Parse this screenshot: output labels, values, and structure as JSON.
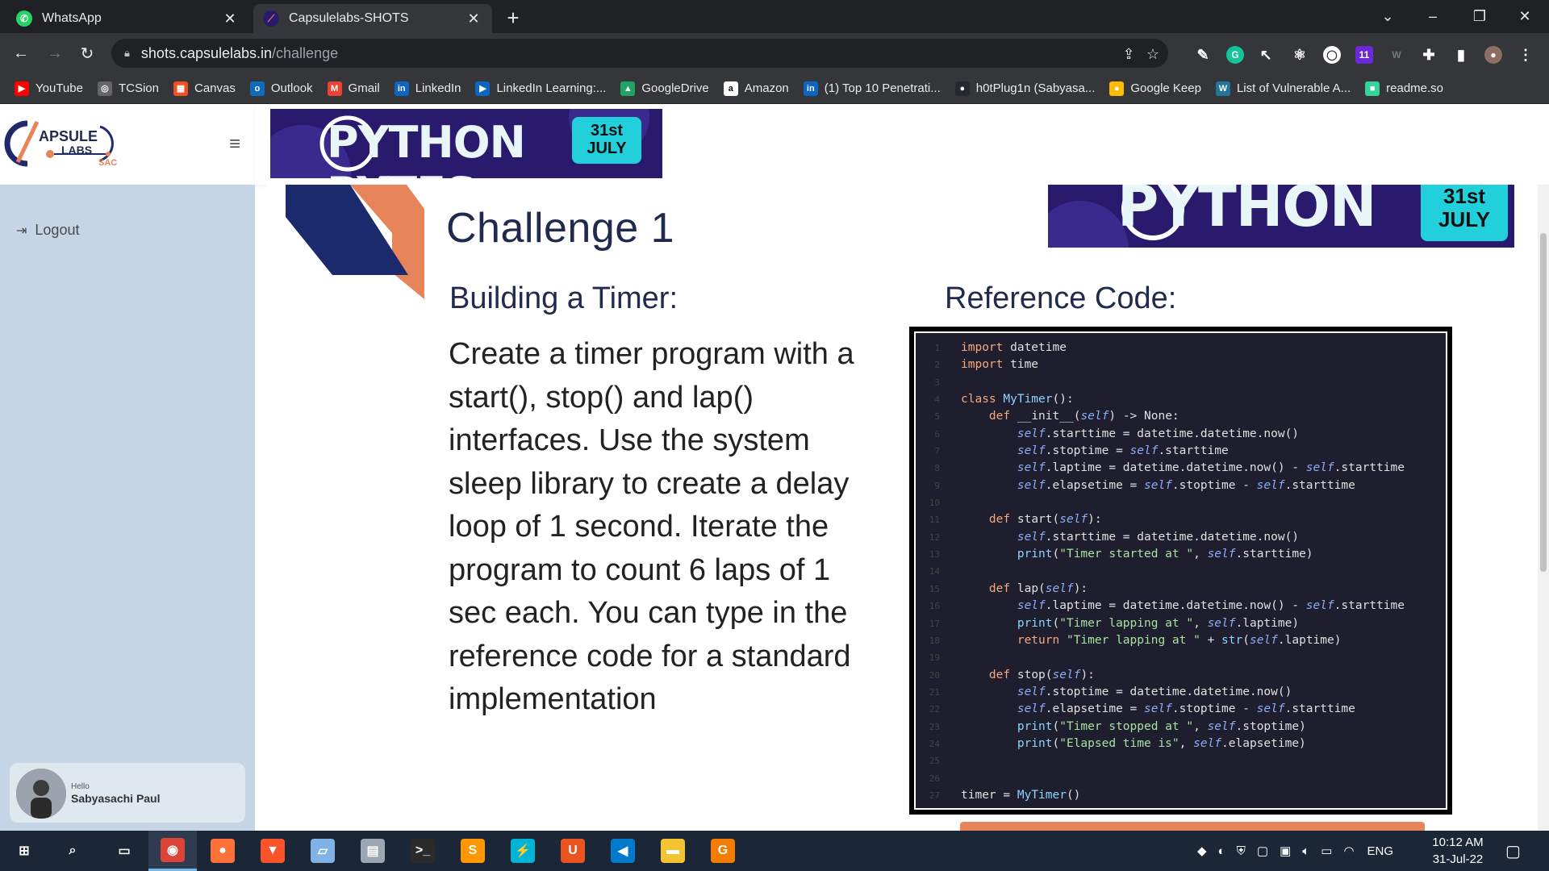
{
  "tabs": [
    {
      "label": "WhatsApp",
      "icon": "whatsapp-icon",
      "color": "#25d366"
    },
    {
      "label": "Capsulelabs-SHOTS",
      "icon": "capsulelabs-icon",
      "color": "#5b6ee1"
    }
  ],
  "window_controls": {
    "minimize": "–",
    "maximize": "❐",
    "close": "✕",
    "dropdown": "⌄"
  },
  "address": {
    "host": "shots.capsulelabs.in",
    "path": "/challenge"
  },
  "bookmarks": [
    {
      "label": "YouTube",
      "color": "#ff0000",
      "glyph": "▶"
    },
    {
      "label": "TCSion",
      "color": "#666",
      "glyph": "◎"
    },
    {
      "label": "Canvas",
      "color": "#f25022",
      "glyph": "▦"
    },
    {
      "label": "Outlook",
      "color": "#0f6cbd",
      "glyph": "o"
    },
    {
      "label": "Gmail",
      "color": "#ea4335",
      "glyph": "M"
    },
    {
      "label": "LinkedIn",
      "color": "#0a66c2",
      "glyph": "in"
    },
    {
      "label": "LinkedIn Learning:...",
      "color": "#0a66c2",
      "glyph": "▶"
    },
    {
      "label": "GoogleDrive",
      "color": "#1fa463",
      "glyph": "▲"
    },
    {
      "label": "Amazon",
      "color": "#fff",
      "glyph": "a"
    },
    {
      "label": "(1) Top 10 Penetrati...",
      "color": "#0a66c2",
      "glyph": "in"
    },
    {
      "label": "h0tPlug1n (Sabyasa...",
      "color": "#24292f",
      "glyph": "●"
    },
    {
      "label": "Google Keep",
      "color": "#fbbc04",
      "glyph": "●"
    },
    {
      "label": "List of Vulnerable A...",
      "color": "#21759b",
      "glyph": "W"
    },
    {
      "label": "readme.so",
      "color": "#34d399",
      "glyph": "■"
    }
  ],
  "sidebar": {
    "logo_text_1": "APSULE",
    "logo_text_2": "LABS",
    "logo_text_3": "SAC",
    "menu_icon": "hamburger-icon",
    "logout_label": "Logout",
    "user": {
      "greeting": "Hello",
      "name": "Sabyasachi Paul"
    }
  },
  "banner": {
    "title": "PYTHON BYTES",
    "date_line1": "31st",
    "date_line2": "JULY"
  },
  "slide": {
    "title": "Challenge 1",
    "left_heading": "Building a Timer:",
    "right_heading": "Reference Code:",
    "description": "Create a timer program with a start(), stop() and lap() interfaces. Use the system sleep library to create a delay loop of 1 second. Iterate the program to count 6 laps of 1 sec each. You can type in the reference code for a standard implementation"
  },
  "code_lines": [
    "import datetime",
    "import time",
    "",
    "class MyTimer():",
    "    def __init__(self) -> None:",
    "        self.starttime = datetime.datetime.now()",
    "        self.stoptime = self.starttime",
    "        self.laptime = datetime.datetime.now() - self.starttime",
    "        self.elapsetime = self.stoptime - self.starttime",
    "",
    "    def start(self):",
    "        self.starttime = datetime.datetime.now()",
    "        print(\"Timer started at \", self.starttime)",
    "",
    "    def lap(self):",
    "        self.laptime = datetime.datetime.now() - self.starttime",
    "        print(\"Timer lapping at \", self.laptime)",
    "        return \"Timer lapping at \" + str(self.laptime)",
    "",
    "    def stop(self):",
    "        self.stoptime = datetime.datetime.now()",
    "        self.elapsetime = self.stoptime - self.starttime",
    "        print(\"Timer stopped at \", self.stoptime)",
    "        print(\"Elapsed time is\", self.elapsetime)",
    "",
    "",
    "timer = MyTimer()"
  ],
  "taskbar": {
    "apps": [
      {
        "name": "start-button",
        "glyph": "⊞",
        "color": "transparent"
      },
      {
        "name": "search-button",
        "glyph": "⌕",
        "color": "transparent"
      },
      {
        "name": "task-view-button",
        "glyph": "▭",
        "color": "transparent"
      },
      {
        "name": "chrome-app",
        "glyph": "◉",
        "color": "#db4437"
      },
      {
        "name": "firefox-app",
        "glyph": "●",
        "color": "#ff7139"
      },
      {
        "name": "brave-app",
        "glyph": "▼",
        "color": "#fb542b"
      },
      {
        "name": "notes-app",
        "glyph": "▱",
        "color": "#7fb2e5"
      },
      {
        "name": "remote-app",
        "glyph": "▤",
        "color": "#9aa6b2"
      },
      {
        "name": "terminal-app",
        "glyph": ">_",
        "color": "#2b2b2b"
      },
      {
        "name": "sublime-app",
        "glyph": "S",
        "color": "#ff9800"
      },
      {
        "name": "flash-app",
        "glyph": "⚡",
        "color": "#00b4d8"
      },
      {
        "name": "ubuntu-app",
        "glyph": "U",
        "color": "#e95420"
      },
      {
        "name": "vscode-app",
        "glyph": "◀",
        "color": "#007acc"
      },
      {
        "name": "explorer-app",
        "glyph": "▬",
        "color": "#f4c430"
      },
      {
        "name": "pdf-app",
        "glyph": "G",
        "color": "#f57c00"
      }
    ],
    "language": "ENG",
    "time": "10:12 AM",
    "date": "31-Jul-22"
  }
}
